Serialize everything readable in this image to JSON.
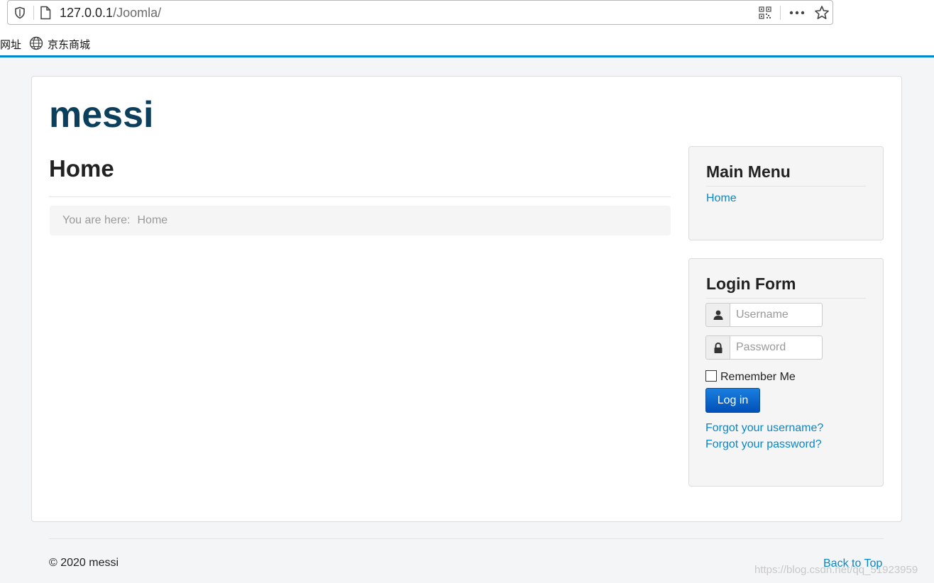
{
  "browser": {
    "url_host": "127.0.0.1",
    "url_path": "/Joomla/",
    "bookmarks": [
      "网址",
      "京东商城"
    ]
  },
  "site": {
    "brand": "messi",
    "page_title": "Home",
    "breadcrumb": {
      "label": "You are here:",
      "current": "Home"
    }
  },
  "sidebar": {
    "main_menu": {
      "title": "Main Menu",
      "items": [
        "Home"
      ]
    },
    "login_form": {
      "title": "Login Form",
      "username_placeholder": "Username",
      "password_placeholder": "Password",
      "remember_label": "Remember Me",
      "login_button": "Log in",
      "forgot_username": "Forgot your username?",
      "forgot_password": "Forgot your password?"
    }
  },
  "footer": {
    "copyright": "© 2020 messi",
    "back_to_top": "Back to Top",
    "watermark": "https://blog.csdn.net/qq_51923959"
  },
  "colors": {
    "accent": "#0088cc",
    "brand": "#0b3f5c",
    "link": "#0b86c6",
    "button": "#0a5fc8"
  }
}
